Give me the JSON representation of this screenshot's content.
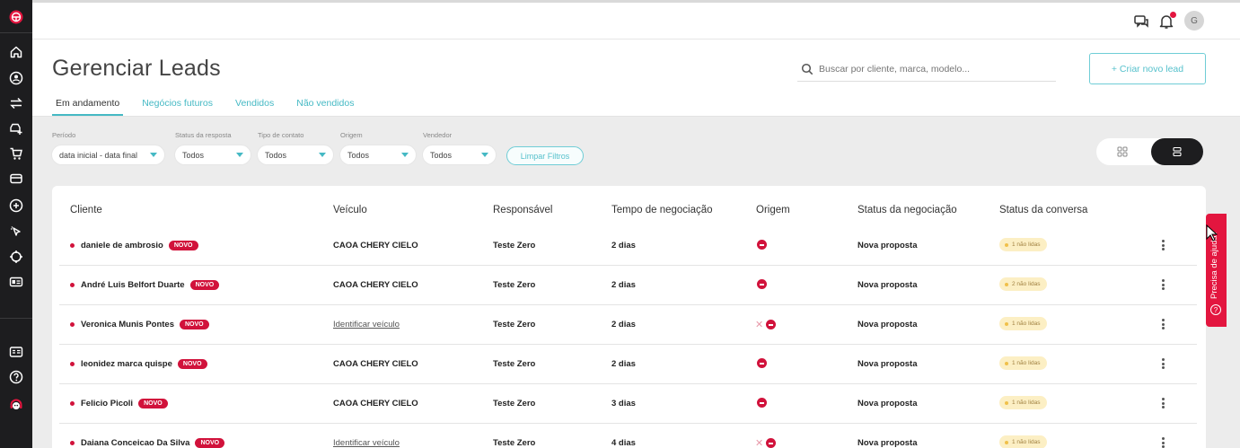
{
  "colors": {
    "brand_red": "#e3163f",
    "accent_teal": "#45b9c4",
    "sidebar_bg": "#1d1d1f"
  },
  "sidebar": {
    "items": [
      {
        "icon": "steering-wheel-logo-icon"
      },
      {
        "icon": "home-icon"
      },
      {
        "icon": "user-circle-icon"
      },
      {
        "icon": "arrows-swap-icon"
      },
      {
        "icon": "car-add-icon"
      },
      {
        "icon": "cart-icon"
      },
      {
        "icon": "card-icon"
      },
      {
        "icon": "plus-circle-icon"
      },
      {
        "icon": "cursor-click-icon"
      },
      {
        "icon": "target-icon"
      },
      {
        "icon": "id-card-icon"
      },
      {
        "icon": "id-badge-icon"
      },
      {
        "icon": "help-circle-icon"
      },
      {
        "icon": "support-agent-icon"
      }
    ]
  },
  "topbar": {
    "avatar_initial": "G",
    "icons": [
      "chat-icon",
      "bell-icon"
    ]
  },
  "header": {
    "title": "Gerenciar Leads",
    "search_placeholder": "Buscar por cliente, marca, modelo...",
    "create_button": "+ Criar novo lead",
    "tabs": [
      "Em andamento",
      "Negócios futuros",
      "Vendidos",
      "Não vendidos"
    ],
    "active_tab": "Em andamento"
  },
  "filters": {
    "periodo": {
      "label": "Período",
      "value": "data inicial - data final"
    },
    "status_resposta": {
      "label": "Status da resposta",
      "value": "Todos"
    },
    "tipo_contato": {
      "label": "Tipo de contato",
      "value": "Todos"
    },
    "origem": {
      "label": "Origem",
      "value": "Todos"
    },
    "vendedor": {
      "label": "Vendedor",
      "value": "Todos"
    },
    "clear_button": "Limpar Filtros",
    "view_mode": "list"
  },
  "table": {
    "headers": {
      "cliente": "Cliente",
      "veiculo": "Veículo",
      "responsavel": "Responsável",
      "tempo": "Tempo de negociação",
      "origem": "Origem",
      "status_negociacao": "Status da negociação",
      "status_conversa": "Status da conversa"
    },
    "badge_label": "NOVO",
    "rows": [
      {
        "cliente": "daniele de ambrosio",
        "veiculo": "CAOA CHERY CIELO",
        "veiculo_link": false,
        "responsavel": "Teste Zero",
        "tempo": "2 dias",
        "origem_x": false,
        "status_negociacao": "Nova proposta",
        "status_conversa": "1 não lidas"
      },
      {
        "cliente": "André Luis Belfort Duarte",
        "veiculo": "CAOA CHERY CIELO",
        "veiculo_link": false,
        "responsavel": "Teste Zero",
        "tempo": "2 dias",
        "origem_x": false,
        "status_negociacao": "Nova proposta",
        "status_conversa": "2 não lidas"
      },
      {
        "cliente": "Veronica Munis Pontes",
        "veiculo": "Identificar veículo",
        "veiculo_link": true,
        "responsavel": "Teste Zero",
        "tempo": "2 dias",
        "origem_x": true,
        "status_negociacao": "Nova proposta",
        "status_conversa": "1 não lidas"
      },
      {
        "cliente": "leonidez marca quispe",
        "veiculo": "CAOA CHERY CIELO",
        "veiculo_link": false,
        "responsavel": "Teste Zero",
        "tempo": "2 dias",
        "origem_x": false,
        "status_negociacao": "Nova proposta",
        "status_conversa": "1 não lidas"
      },
      {
        "cliente": "Felicio Picoli",
        "veiculo": "CAOA CHERY CIELO",
        "veiculo_link": false,
        "responsavel": "Teste Zero",
        "tempo": "3 dias",
        "origem_x": false,
        "status_negociacao": "Nova proposta",
        "status_conversa": "1 não lidas"
      },
      {
        "cliente": "Daiana Conceicao Da Silva",
        "veiculo": "Identificar veículo",
        "veiculo_link": true,
        "responsavel": "Teste Zero",
        "tempo": "4 dias",
        "origem_x": true,
        "status_negociacao": "Nova proposta",
        "status_conversa": "1 não lidas"
      }
    ]
  },
  "help_tab": {
    "label": "Precisa de ajuda?"
  }
}
